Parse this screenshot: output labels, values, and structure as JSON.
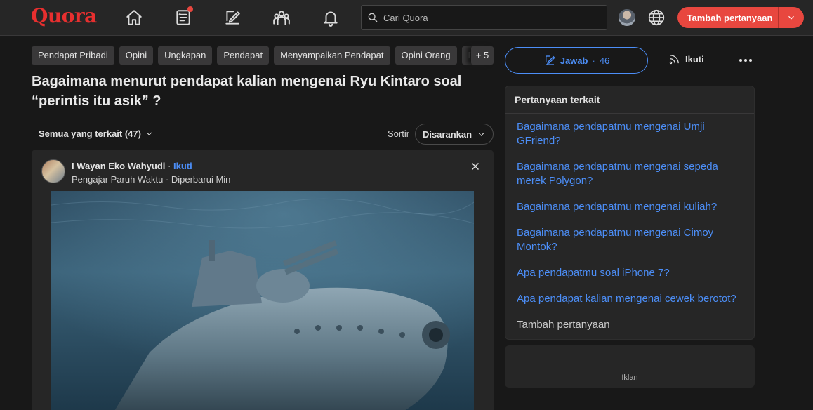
{
  "header": {
    "logo": "Quora",
    "search_placeholder": "Cari Quora",
    "ask_button": "Tambah pertanyaan",
    "nav_icons": [
      "home-icon",
      "following-icon",
      "answer-icon",
      "spaces-icon",
      "notifications-icon"
    ]
  },
  "topics": [
    "Pendapat Pribadi",
    "Opini",
    "Ungkapan",
    "Pendapat",
    "Menyampaikan Pendapat",
    "Opini Orang",
    "Pe"
  ],
  "topics_more": "+ 5",
  "question": {
    "title": "Bagaimana menurut pendapat kalian mengenai Ryu Kintaro soal “perintis itu asik” ?"
  },
  "filter": {
    "all_related": "Semua yang terkait (47)",
    "sort_label": "Sortir",
    "sort_value": "Disarankan"
  },
  "answer": {
    "author": "I Wayan Eko Wahyudi",
    "separator": "·",
    "follow": "Ikuti",
    "meta": "Pengajar Paruh Waktu · Diperbarui Min"
  },
  "actions": {
    "answer_label": "Jawab",
    "answer_sep": "·",
    "answer_count": "46",
    "follow_label": "Ikuti"
  },
  "related": {
    "title": "Pertanyaan terkait",
    "items": [
      "Bagaimana pendapatmu mengenai Umji GFriend?",
      "Bagaimana pendapatmu mengenai sepeda merek Polygon?",
      "Bagaimana pendapatmu mengenai kuliah?",
      "Bagaimana pendapatmu mengenai Cimoy Montok?",
      "Apa pendapatmu soal iPhone 7?",
      "Apa pendapat kalian mengenai cewek berotot?"
    ],
    "add_question": "Tambah pertanyaan"
  },
  "ad": {
    "label": "Iklan"
  },
  "colors": {
    "brand": "#e72f2f",
    "accent_blue": "#4c8ef7",
    "ask_button": "#e8473f",
    "background": "#181818",
    "surface": "#262626"
  }
}
